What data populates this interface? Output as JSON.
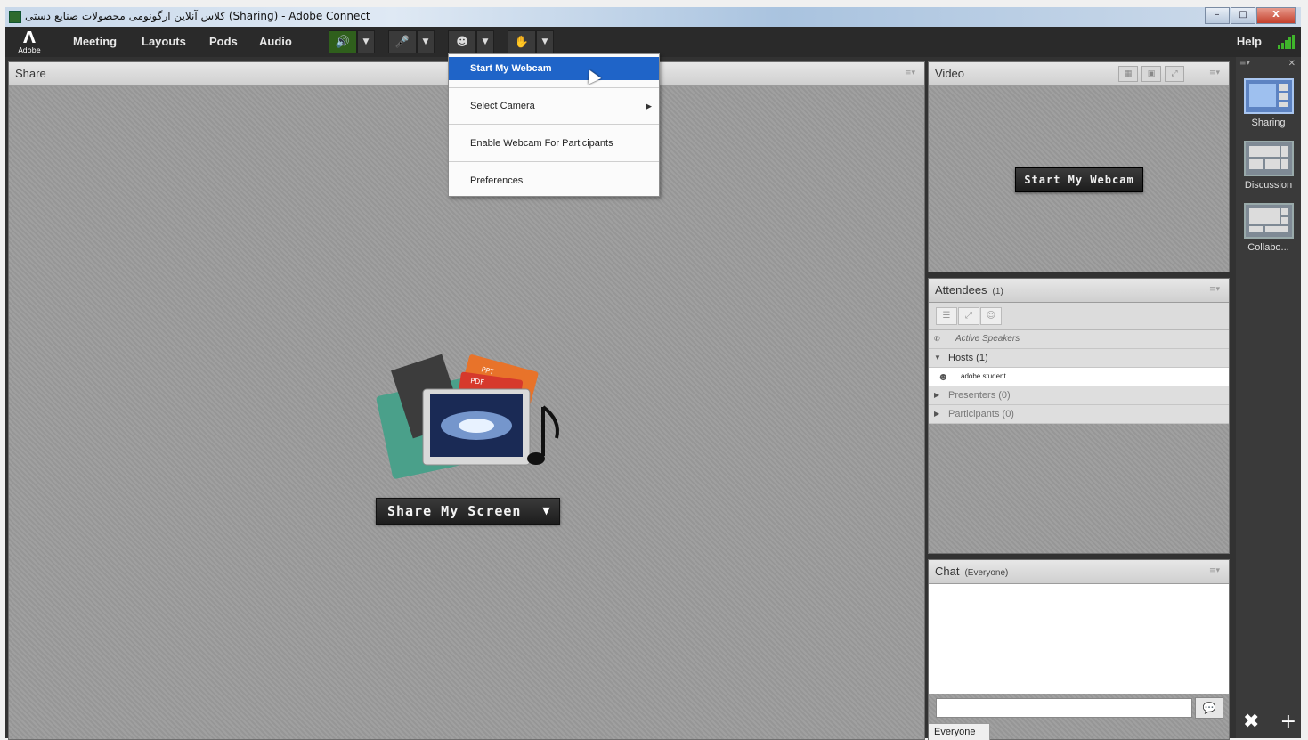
{
  "window": {
    "title": "كلاس آنلاین ارگونومی محصولات صنایع دستی (Sharing) - Adobe Connect",
    "buttons": [
      "–",
      "□",
      "X"
    ]
  },
  "menubar": {
    "logo": "Adobe",
    "items": [
      "Meeting",
      "Layouts",
      "Pods",
      "Audio"
    ],
    "help": "Help",
    "accent_color": "#3fb52b"
  },
  "share_pod": {
    "title": "Share",
    "share_button": "Share My Screen"
  },
  "video_pod": {
    "title": "Video",
    "start_webcam_button": "Start My Webcam"
  },
  "attendees_pod": {
    "title": "Attendees",
    "count": "(1)",
    "active_speakers": "Active Speakers",
    "hosts": "Hosts (1)",
    "host_name": "adobe student",
    "presenters": "Presenters (0)",
    "participants": "Participants (0)"
  },
  "chat_pod": {
    "title": "Chat",
    "scope": "(Everyone)",
    "input_value": "",
    "tab": "Everyone"
  },
  "webcam_menu": {
    "items": [
      "Start My Webcam",
      "Select Camera",
      "Enable Webcam For Participants",
      "Preferences"
    ],
    "highlight_color": "#1f64c8"
  },
  "layouts": {
    "items": [
      "Sharing",
      "Discussion",
      "Collabo..."
    ],
    "active": "Sharing"
  }
}
